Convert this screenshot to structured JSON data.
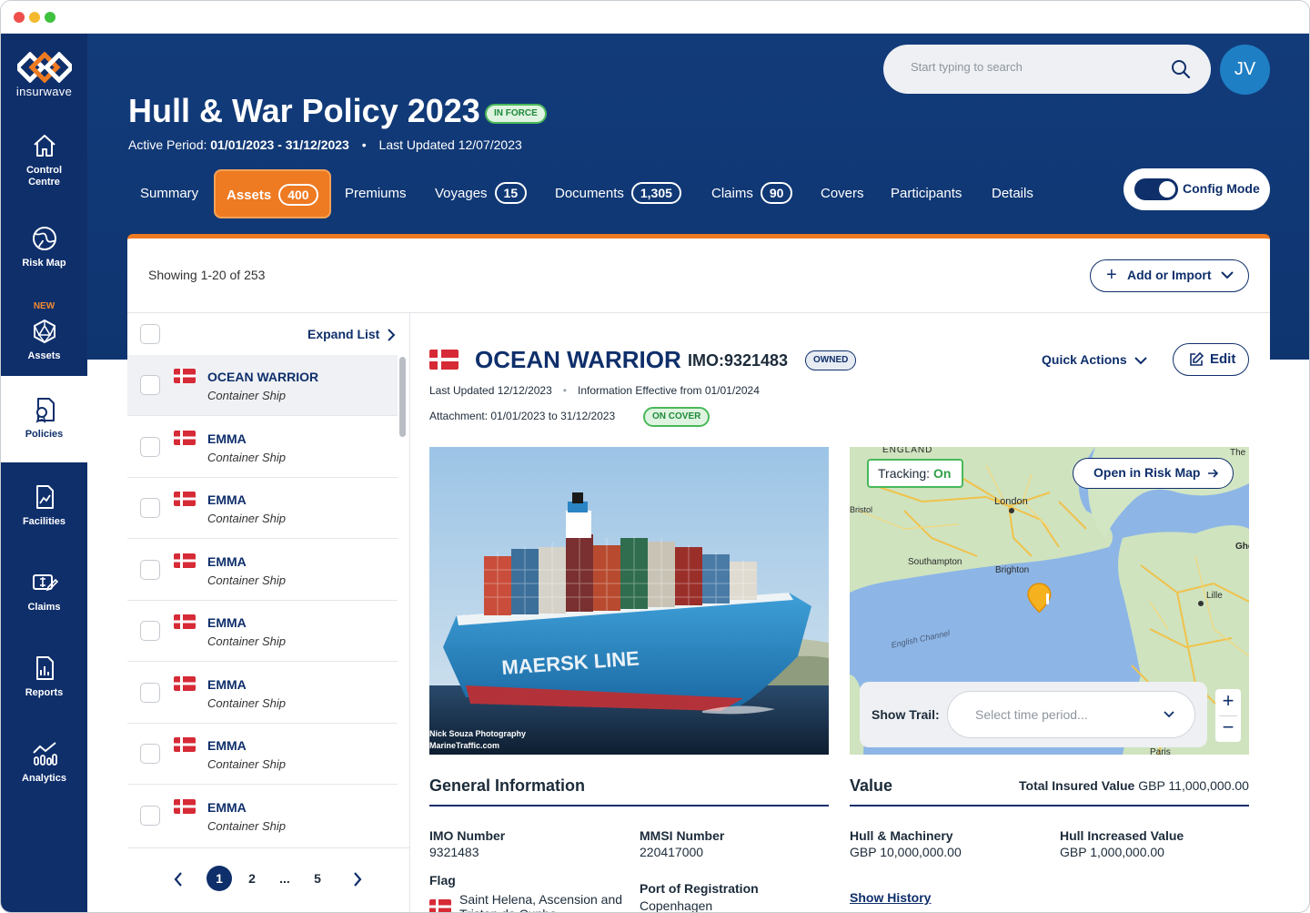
{
  "brand": {
    "name": "insurwave"
  },
  "sidebar": {
    "items": [
      {
        "label": "Control Centre",
        "icon": "home-icon"
      },
      {
        "label": "Risk Map",
        "icon": "globe-icon"
      },
      {
        "label": "Assets",
        "icon": "polyhedron-icon",
        "badge": "NEW"
      },
      {
        "label": "Policies",
        "icon": "policy-icon",
        "active": true
      },
      {
        "label": "Facilities",
        "icon": "facilities-icon"
      },
      {
        "label": "Claims",
        "icon": "claims-icon"
      },
      {
        "label": "Reports",
        "icon": "reports-icon"
      },
      {
        "label": "Analytics",
        "icon": "analytics-icon"
      }
    ]
  },
  "header": {
    "title": "Hull & War Policy 2023",
    "status": "IN FORCE",
    "active_period_label": "Active Period:",
    "active_period": "01/01/2023 - 31/12/2023",
    "last_updated": "Last Updated 12/07/2023",
    "search_placeholder": "Start typing to search",
    "avatar_initials": "JV",
    "config_mode_label": "Config Mode"
  },
  "tabs": [
    {
      "label": "Summary"
    },
    {
      "label": "Assets",
      "count": "400",
      "active": true
    },
    {
      "label": "Premiums"
    },
    {
      "label": "Voyages",
      "count": "15"
    },
    {
      "label": "Documents",
      "count": "1,305"
    },
    {
      "label": "Claims",
      "count": "90"
    },
    {
      "label": "Covers"
    },
    {
      "label": "Participants"
    },
    {
      "label": "Details"
    }
  ],
  "toolbar": {
    "showing": "Showing 1-20 of 253",
    "add_import_label": "Add or Import"
  },
  "list": {
    "expand_label": "Expand List",
    "rows": [
      {
        "name": "OCEAN WARRIOR",
        "type": "Container Ship"
      },
      {
        "name": "EMMA",
        "type": "Container Ship"
      },
      {
        "name": "EMMA",
        "type": "Container Ship"
      },
      {
        "name": "EMMA",
        "type": "Container Ship"
      },
      {
        "name": "EMMA",
        "type": "Container Ship"
      },
      {
        "name": "EMMA",
        "type": "Container Ship"
      },
      {
        "name": "EMMA",
        "type": "Container Ship"
      },
      {
        "name": "EMMA",
        "type": "Container Ship"
      }
    ],
    "pagination": {
      "pages": [
        "1",
        "2",
        "...",
        "5"
      ],
      "current": "1"
    }
  },
  "detail": {
    "name": "OCEAN WARRIOR",
    "imo": "IMO:9321483",
    "ownership": "OWNED",
    "quick_actions_label": "Quick Actions",
    "edit_label": "Edit",
    "last_updated": "Last Updated 12/12/2023",
    "info_effective": "Information Effective from 01/01/2024",
    "attachment": "Attachment: 01/01/2023 to 31/12/2023",
    "cover_status": "ON COVER",
    "photo_credit_line1": "Nick Souza Photography",
    "photo_credit_line2": "MarineTraffic.com",
    "map": {
      "tracking_label": "Tracking:",
      "tracking_value": "On",
      "open_risk_map_label": "Open in Risk Map",
      "show_trail_label": "Show Trail:",
      "trail_placeholder": "Select time period...",
      "labels": {
        "england": "ENGLAND",
        "london": "London",
        "bristol": "Bristol",
        "southampton": "Southampton",
        "brighton": "Brighton",
        "english_channel": "English Channel",
        "lille": "Lille",
        "the": "The",
        "ghe": "Ghe",
        "paris": "Paris"
      }
    },
    "general_info": {
      "title": "General Information",
      "imo_number_label": "IMO Number",
      "imo_number": "9321483",
      "mmsi_label": "MMSI Number",
      "mmsi": "220417000",
      "flag_label": "Flag",
      "flag_value": "Saint Helena, Ascension and Tristan da Cunha",
      "port_label": "Port of Registration",
      "port": "Copenhagen"
    },
    "value": {
      "title": "Value",
      "total_label": "Total Insured Value",
      "total": "GBP 11,000,000.00",
      "hull_machinery_label": "Hull & Machinery",
      "hull_machinery": "GBP 10,000,000.00",
      "hull_increased_label": "Hull Increased Value",
      "hull_increased": "GBP 1,000,000.00",
      "show_history": "Show History"
    }
  },
  "colors": {
    "navy": "#0f2f6b",
    "accent_orange": "#ee7a22",
    "success_green": "#49b85a",
    "denmark_red": "#d62a36"
  }
}
